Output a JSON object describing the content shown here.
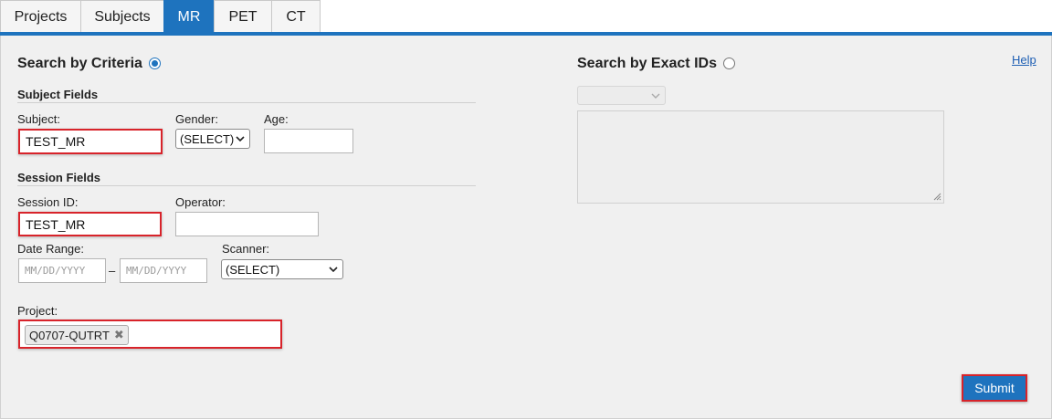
{
  "tabs": [
    {
      "label": "Projects",
      "active": false
    },
    {
      "label": "Subjects",
      "active": false
    },
    {
      "label": "MR",
      "active": true
    },
    {
      "label": "PET",
      "active": false
    },
    {
      "label": "CT",
      "active": false
    }
  ],
  "colors": {
    "accent": "#1e73be",
    "highlight": "#d8232a",
    "panel_bg": "#f0f0f0"
  },
  "criteria": {
    "title": "Search by Criteria",
    "selected": true,
    "subject_fields": {
      "heading": "Subject Fields",
      "subject_label": "Subject:",
      "subject_value": "TEST_MR",
      "gender_label": "Gender:",
      "gender_value": "(SELECT)",
      "age_label": "Age:",
      "age_value": ""
    },
    "session_fields": {
      "heading": "Session Fields",
      "session_id_label": "Session ID:",
      "session_id_value": "TEST_MR",
      "operator_label": "Operator:",
      "operator_value": "",
      "date_range_label": "Date Range:",
      "date_from_placeholder": "MM/DD/YYYY",
      "date_separator": "–",
      "date_to_placeholder": "MM/DD/YYYY",
      "scanner_label": "Scanner:",
      "scanner_value": "(SELECT)"
    },
    "project": {
      "label": "Project:",
      "tags": [
        "Q0707-QUTRT"
      ],
      "remove_icon": "✖"
    }
  },
  "exact_ids": {
    "title": "Search by Exact IDs",
    "selected": false,
    "id_type_value": "",
    "ids_value": ""
  },
  "help_label": "Help",
  "submit_label": "Submit"
}
